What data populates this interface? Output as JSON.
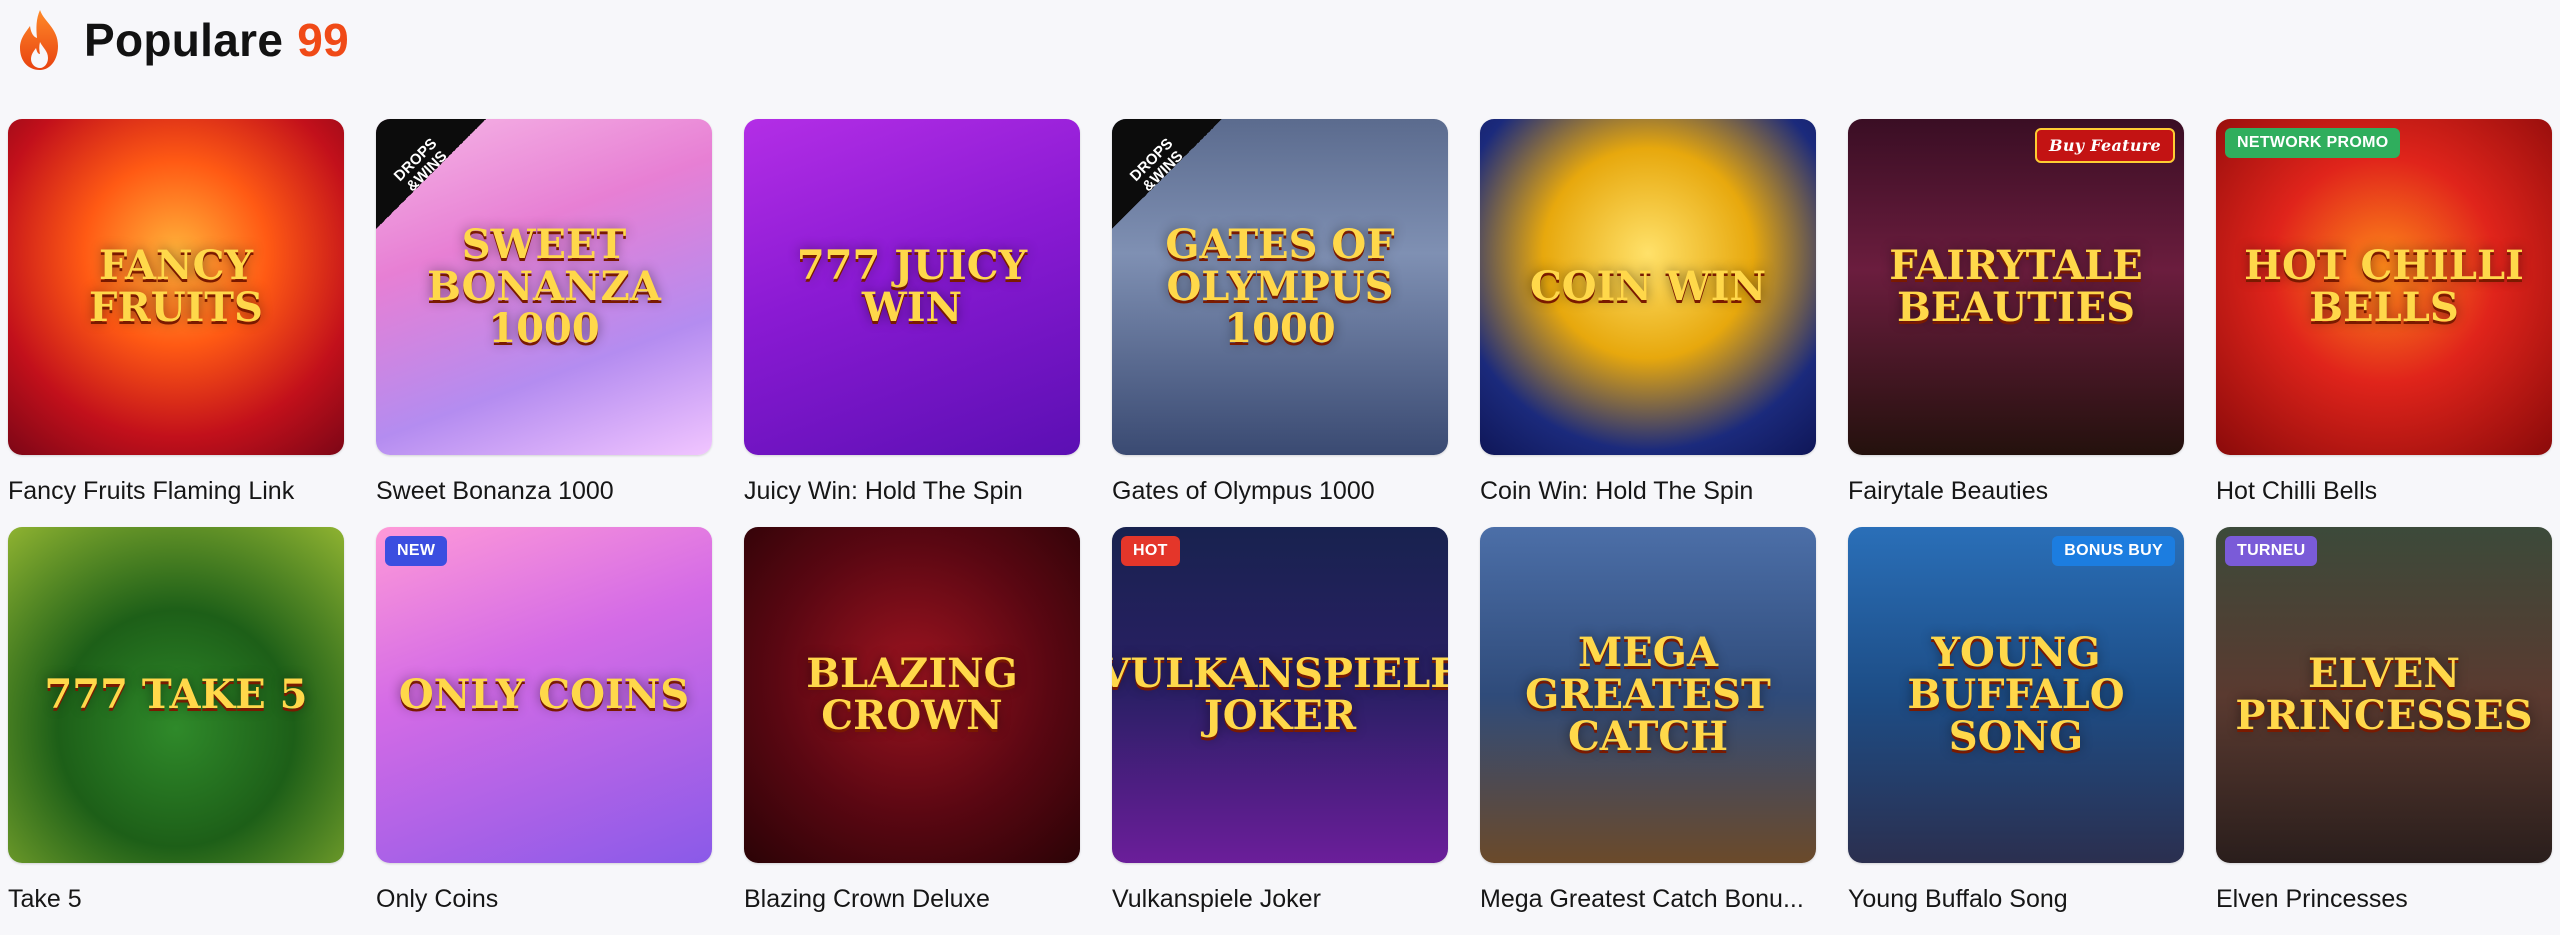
{
  "header": {
    "title": "Populare",
    "count": "99"
  },
  "games": [
    {
      "name": "Fancy Fruits Flaming Link",
      "art": "Fancy Fruits",
      "bg": "radial-gradient(circle at 50% 40%, #ffb23a 0%, #ff5a14 35%, #c2101b 70%, #7c0616 100%)",
      "badge": null
    },
    {
      "name": "Sweet Bonanza 1000",
      "art": "Sweet Bonanza 1000",
      "bg": "linear-gradient(160deg, #f6b6e6 0%, #e77fd4 35%, #b48cf0 70%, #f1c5ff 100%)",
      "badge": {
        "type": "drops",
        "text": "DROPS &WINS"
      }
    },
    {
      "name": "Juicy Win: Hold The Spin",
      "art": "777 Juicy Win",
      "bg": "linear-gradient(160deg, #b32ee6 0%, #8a1ad3 45%, #5b0fb3 100%)",
      "badge": null
    },
    {
      "name": "Gates of Olympus 1000",
      "art": "Gates of Olympus 1000",
      "bg": "linear-gradient(180deg, #5b6b8e 0%, #7f90b3 40%, #3a4a72 100%)",
      "badge": {
        "type": "drops",
        "text": "DROPS &WINS"
      }
    },
    {
      "name": "Coin Win: Hold The Spin",
      "art": "Coin Win",
      "bg": "radial-gradient(circle at 50% 40%, #ffe16a 0%, #e7a80d 40%, #1b2a7c 75%, #0f1657 100%)",
      "badge": null
    },
    {
      "name": "Fairytale Beauties",
      "art": "Fairytale Beauties",
      "bg": "linear-gradient(180deg, #3a0e24 0%, #6b1d3e 45%, #24110d 100%)",
      "badge": {
        "type": "buy",
        "text": "Buy Feature"
      }
    },
    {
      "name": "Hot Chilli Bells",
      "art": "Hot Chilli Bells",
      "bg": "radial-gradient(circle at 50% 45%, #ff8a1a 0%, #e0241b 45%, #8a0a0a 100%)",
      "badge": {
        "type": "green",
        "text": "NETWORK PROMO"
      }
    },
    {
      "name": "Take 5",
      "art": "777 Take 5",
      "bg": "radial-gradient(circle at 50% 60%, #2f8a2a 0%, #1d5f18 45%, #8fb331 100%)",
      "badge": null
    },
    {
      "name": "Only Coins",
      "art": "Only Coins",
      "bg": "linear-gradient(160deg, #ff9ad8 0%, #d46be6 40%, #8a5ae8 100%)",
      "badge": {
        "type": "blue",
        "text": "NEW"
      }
    },
    {
      "name": "Blazing Crown Deluxe",
      "art": "Blazing Crown",
      "bg": "radial-gradient(circle at 50% 45%, #9d1420 0%, #5a0712 55%, #2b0306 100%)",
      "badge": null
    },
    {
      "name": "Vulkanspiele Joker",
      "art": "Vulkanspiele Joker",
      "bg": "linear-gradient(180deg, #18224f 0%, #2b1f66 50%, #6b1e9a 100%)",
      "badge": {
        "type": "hot",
        "text": "HOT"
      }
    },
    {
      "name": "Mega Greatest Catch Bonu...",
      "art": "Mega Greatest Catch",
      "bg": "linear-gradient(180deg, #4c6fa8 0%, #2f4b7a 50%, #6b4a2a 100%)",
      "badge": null
    },
    {
      "name": "Young Buffalo Song",
      "art": "Young Buffalo Song",
      "bg": "linear-gradient(180deg, #2a6fb8 0%, #1d4d86 50%, #2b2f4f 100%)",
      "badge": {
        "type": "sky",
        "text": "BONUS BUY"
      }
    },
    {
      "name": "Elven Princesses",
      "art": "Elven Princesses",
      "bg": "linear-gradient(180deg, #3c4a3a 0%, #5a3a30 50%, #2a1e1c 100%)",
      "badge": {
        "type": "violet",
        "text": "TURNEU"
      }
    }
  ],
  "colors": {
    "accent": "#f04a17",
    "page_bg": "#f7f7fa"
  },
  "icons": {
    "header": "flame-icon"
  }
}
